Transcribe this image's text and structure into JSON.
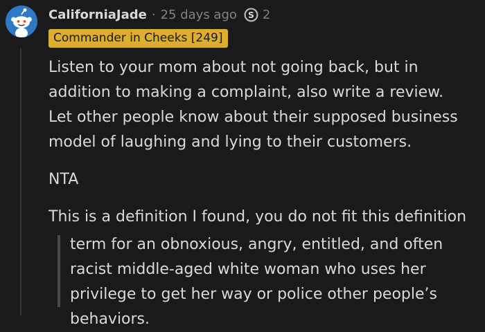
{
  "comment": {
    "username": "CaliforniaJade",
    "separator": "·",
    "timestamp": "25 days ago",
    "award": {
      "icon": "silver-award-icon",
      "count": "2"
    },
    "flair": {
      "text": "Commander in Cheeks [249]",
      "color": "#dcae2f"
    },
    "paragraphs": [
      "Listen to your mom about not going back, but in addition to making a complaint, also write a review. Let other people know about their supposed business model of laughing and lying to their customers.",
      "NTA",
      "This is a definition I found, you do not fit this definition"
    ],
    "quote": "term for an obnoxious, angry, entitled, and often racist middle-aged white woman who uses her privilege to get her way or police other people’s behaviors."
  },
  "colors": {
    "background": "#1a1a1b",
    "text": "#d7dadc",
    "meta": "#818384",
    "avatar": "#2f79c4"
  }
}
